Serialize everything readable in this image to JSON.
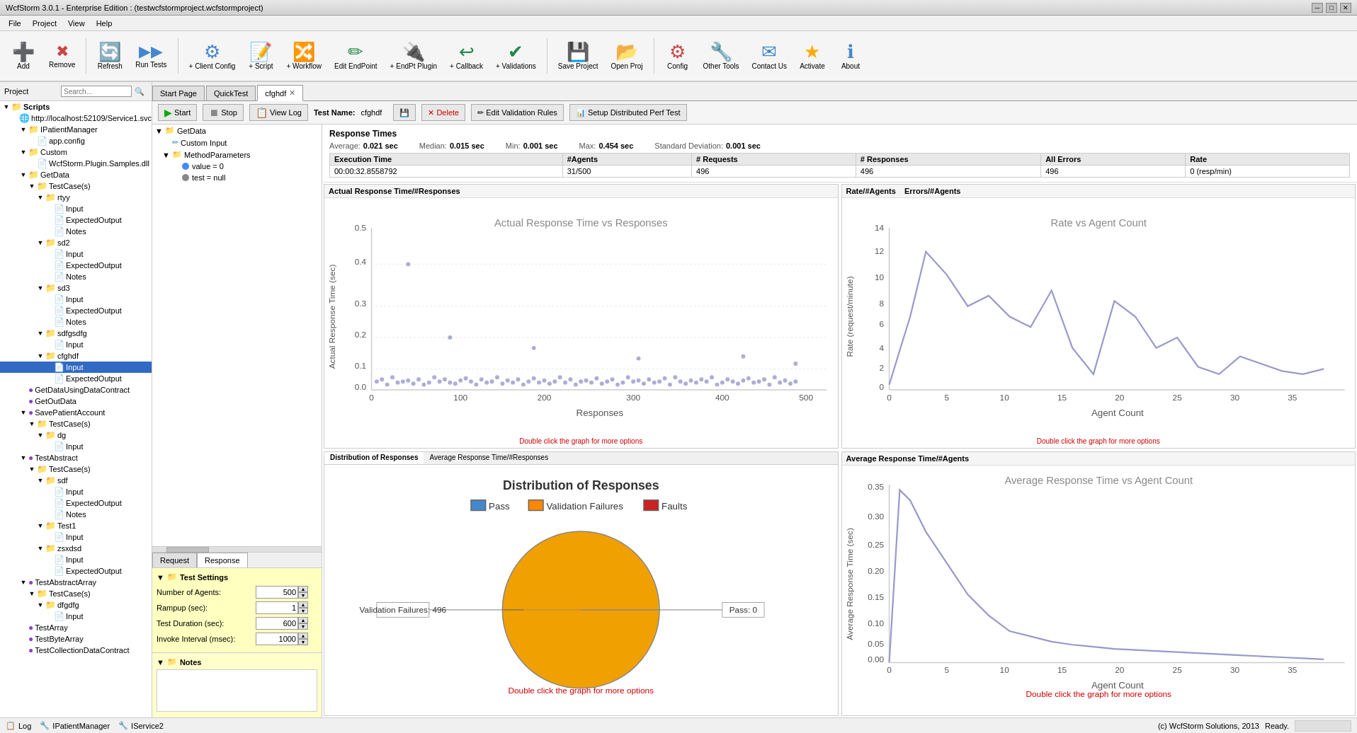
{
  "titleBar": {
    "text": "WcfStorm 3.0.1 - Enterprise Edition : (testwcfstormproject.wcfstormproject)",
    "minBtn": "─",
    "maxBtn": "□",
    "closeBtn": "✕"
  },
  "menuBar": {
    "items": [
      "File",
      "Project",
      "View",
      "Help"
    ]
  },
  "toolbar": {
    "buttons": [
      {
        "id": "add",
        "label": "Add",
        "icon": "➕",
        "class": "btn-add"
      },
      {
        "id": "remove",
        "label": "Remove",
        "icon": "✖",
        "class": "btn-remove"
      },
      {
        "id": "refresh",
        "label": "Refresh",
        "icon": "🔄",
        "class": "btn-refresh"
      },
      {
        "id": "run-tests",
        "label": "Run Tests",
        "icon": "▶",
        "class": "btn-run"
      },
      {
        "id": "client-config",
        "label": "+ Client Config",
        "icon": "⚙",
        "class": "btn-client"
      },
      {
        "id": "script",
        "label": "+ Script",
        "icon": "📝",
        "class": "btn-script"
      },
      {
        "id": "workflow",
        "label": "+ Workflow",
        "icon": "🔀",
        "class": "btn-workflow"
      },
      {
        "id": "edit-endpoint",
        "label": "Edit EndPoint",
        "icon": "✏",
        "class": "btn-endpoint"
      },
      {
        "id": "endpt-plugin",
        "label": "+ EndPt Plugin",
        "icon": "🔌",
        "class": "btn-endpt"
      },
      {
        "id": "callback",
        "label": "+ Callback",
        "icon": "↩",
        "class": "btn-callback"
      },
      {
        "id": "validations",
        "label": "+ Validations",
        "icon": "✔",
        "class": "btn-validations"
      },
      {
        "id": "save-project",
        "label": "Save Project",
        "icon": "💾",
        "class": "btn-save"
      },
      {
        "id": "open-proj",
        "label": "Open Proj",
        "icon": "📂",
        "class": "btn-openproj"
      },
      {
        "id": "config",
        "label": "Config",
        "icon": "⚙",
        "class": "btn-config"
      },
      {
        "id": "other-tools",
        "label": "Other Tools",
        "icon": "🔧",
        "class": "btn-tools"
      },
      {
        "id": "contact-us",
        "label": "Contact Us",
        "icon": "✉",
        "class": "btn-contact"
      },
      {
        "id": "activate",
        "label": "Activate",
        "icon": "★",
        "class": "btn-activate"
      },
      {
        "id": "about",
        "label": "About",
        "icon": "ℹ",
        "class": "btn-about"
      }
    ]
  },
  "projectPanel": {
    "header": "Project",
    "searchPlaceholder": "Search...",
    "tree": [
      {
        "id": 1,
        "indent": 0,
        "expand": "▼",
        "icon": "📁",
        "iconClass": "icon-folder",
        "label": "Scripts",
        "bold": true
      },
      {
        "id": 2,
        "indent": 1,
        "expand": " ",
        "icon": "🌐",
        "iconClass": "icon-blue",
        "label": "http://localhost:52109/Service1.svc"
      },
      {
        "id": 3,
        "indent": 2,
        "expand": "▼",
        "icon": "📁",
        "iconClass": "icon-folder",
        "label": "IPatientManager"
      },
      {
        "id": 4,
        "indent": 3,
        "expand": " ",
        "icon": "📄",
        "iconClass": "icon-gray",
        "label": "app.config"
      },
      {
        "id": 5,
        "indent": 2,
        "expand": "▼",
        "icon": "📁",
        "iconClass": "icon-folder",
        "label": "Custom"
      },
      {
        "id": 6,
        "indent": 3,
        "expand": " ",
        "icon": "📄",
        "iconClass": "icon-gray",
        "label": "WcfStorm.Plugin.Samples.dll"
      },
      {
        "id": 7,
        "indent": 2,
        "expand": "▼",
        "icon": "📁",
        "iconClass": "icon-folder",
        "label": "GetData"
      },
      {
        "id": 8,
        "indent": 3,
        "expand": "▼",
        "icon": "📁",
        "iconClass": "icon-folder",
        "label": "TestCase(s)"
      },
      {
        "id": 9,
        "indent": 4,
        "expand": "▼",
        "icon": "📁",
        "iconClass": "icon-folder",
        "label": "rtyy"
      },
      {
        "id": 10,
        "indent": 5,
        "expand": " ",
        "icon": "📄",
        "iconClass": "icon-orange",
        "label": "Input"
      },
      {
        "id": 11,
        "indent": 5,
        "expand": " ",
        "icon": "📄",
        "iconClass": "icon-green",
        "label": "ExpectedOutput"
      },
      {
        "id": 12,
        "indent": 5,
        "expand": " ",
        "icon": "📄",
        "iconClass": "icon-gray",
        "label": "Notes"
      },
      {
        "id": 13,
        "indent": 4,
        "expand": "▼",
        "icon": "📁",
        "iconClass": "icon-folder",
        "label": "sd2"
      },
      {
        "id": 14,
        "indent": 5,
        "expand": " ",
        "icon": "📄",
        "iconClass": "icon-orange",
        "label": "Input"
      },
      {
        "id": 15,
        "indent": 5,
        "expand": " ",
        "icon": "📄",
        "iconClass": "icon-green",
        "label": "ExpectedOutput"
      },
      {
        "id": 16,
        "indent": 5,
        "expand": " ",
        "icon": "📄",
        "iconClass": "icon-gray",
        "label": "Notes"
      },
      {
        "id": 17,
        "indent": 4,
        "expand": "▼",
        "icon": "📁",
        "iconClass": "icon-folder",
        "label": "sd3"
      },
      {
        "id": 18,
        "indent": 5,
        "expand": " ",
        "icon": "📄",
        "iconClass": "icon-orange",
        "label": "Input"
      },
      {
        "id": 19,
        "indent": 5,
        "expand": " ",
        "icon": "📄",
        "iconClass": "icon-green",
        "label": "ExpectedOutput"
      },
      {
        "id": 20,
        "indent": 5,
        "expand": " ",
        "icon": "📄",
        "iconClass": "icon-gray",
        "label": "Notes"
      },
      {
        "id": 21,
        "indent": 4,
        "expand": "▼",
        "icon": "📁",
        "iconClass": "icon-folder",
        "label": "sdfgsdfg"
      },
      {
        "id": 22,
        "indent": 5,
        "expand": " ",
        "icon": "📄",
        "iconClass": "icon-orange",
        "label": "Input"
      },
      {
        "id": 23,
        "indent": 4,
        "expand": "▼",
        "icon": "📁",
        "iconClass": "icon-folder",
        "label": "cfghdf"
      },
      {
        "id": 24,
        "indent": 5,
        "expand": " ",
        "icon": "📄",
        "iconClass": "icon-blue",
        "label": "Input",
        "selected": true
      },
      {
        "id": 25,
        "indent": 5,
        "expand": " ",
        "icon": "📄",
        "iconClass": "icon-green",
        "label": "ExpectedOutput"
      },
      {
        "id": 26,
        "indent": 2,
        "expand": " ",
        "icon": "📄",
        "iconClass": "icon-purple",
        "label": "GetDataUsingDataContract"
      },
      {
        "id": 27,
        "indent": 2,
        "expand": " ",
        "icon": "📄",
        "iconClass": "icon-purple",
        "label": "GetOutData"
      },
      {
        "id": 28,
        "indent": 2,
        "expand": " ",
        "icon": "📄",
        "iconClass": "icon-purple",
        "label": "SavePatientAccount"
      },
      {
        "id": 29,
        "indent": 3,
        "expand": "▼",
        "icon": "📁",
        "iconClass": "icon-folder",
        "label": "TestCase(s)"
      },
      {
        "id": 30,
        "indent": 4,
        "expand": "▼",
        "icon": "📁",
        "iconClass": "icon-folder",
        "label": "dg"
      },
      {
        "id": 31,
        "indent": 5,
        "expand": " ",
        "icon": "📄",
        "iconClass": "icon-orange",
        "label": "Input"
      },
      {
        "id": 32,
        "indent": 2,
        "expand": " ",
        "icon": "📄",
        "iconClass": "icon-purple",
        "label": "TestAbstract"
      },
      {
        "id": 33,
        "indent": 3,
        "expand": "▼",
        "icon": "📁",
        "iconClass": "icon-folder",
        "label": "TestCase(s)"
      },
      {
        "id": 34,
        "indent": 4,
        "expand": "▼",
        "icon": "📁",
        "iconClass": "icon-folder",
        "label": "sdf"
      },
      {
        "id": 35,
        "indent": 5,
        "expand": " ",
        "icon": "📄",
        "iconClass": "icon-orange",
        "label": "Input"
      },
      {
        "id": 36,
        "indent": 5,
        "expand": " ",
        "icon": "📄",
        "iconClass": "icon-green",
        "label": "ExpectedOutput"
      },
      {
        "id": 37,
        "indent": 5,
        "expand": " ",
        "icon": "📄",
        "iconClass": "icon-gray",
        "label": "Notes"
      },
      {
        "id": 38,
        "indent": 4,
        "expand": "▼",
        "icon": "📁",
        "iconClass": "icon-folder",
        "label": "Test1"
      },
      {
        "id": 39,
        "indent": 5,
        "expand": " ",
        "icon": "📄",
        "iconClass": "icon-orange",
        "label": "Input"
      },
      {
        "id": 40,
        "indent": 4,
        "expand": "▼",
        "icon": "📁",
        "iconClass": "icon-folder",
        "label": "zsxdsd"
      },
      {
        "id": 41,
        "indent": 5,
        "expand": " ",
        "icon": "📄",
        "iconClass": "icon-blue",
        "label": "Input"
      },
      {
        "id": 42,
        "indent": 5,
        "expand": " ",
        "icon": "📄",
        "iconClass": "icon-green",
        "label": "ExpectedOutput"
      },
      {
        "id": 43,
        "indent": 2,
        "expand": " ",
        "icon": "📄",
        "iconClass": "icon-purple",
        "label": "TestAbstractArray"
      },
      {
        "id": 44,
        "indent": 3,
        "expand": "▼",
        "icon": "📁",
        "iconClass": "icon-folder",
        "label": "TestCase(s)"
      },
      {
        "id": 45,
        "indent": 4,
        "expand": "▼",
        "icon": "📁",
        "iconClass": "icon-folder",
        "label": "dfgdfg"
      },
      {
        "id": 46,
        "indent": 5,
        "expand": " ",
        "icon": "📄",
        "iconClass": "icon-orange",
        "label": "Input"
      },
      {
        "id": 47,
        "indent": 2,
        "expand": " ",
        "icon": "📄",
        "iconClass": "icon-purple",
        "label": "TestArray"
      },
      {
        "id": 48,
        "indent": 2,
        "expand": " ",
        "icon": "📄",
        "iconClass": "icon-purple",
        "label": "TestByteArray"
      },
      {
        "id": 49,
        "indent": 2,
        "expand": " ",
        "icon": "📄",
        "iconClass": "icon-purple",
        "label": "TestCollectionDataContract"
      }
    ]
  },
  "tabs": {
    "items": [
      {
        "label": "Start Page",
        "closable": false,
        "active": false
      },
      {
        "label": "QuickTest",
        "closable": false,
        "active": false
      },
      {
        "label": "cfghdf",
        "closable": true,
        "active": true
      }
    ]
  },
  "testPanel": {
    "startBtn": "▶ Start",
    "stopBtn": "⏹ Stop",
    "viewLogBtn": "📋 View Log",
    "testNameLabel": "Test Name:",
    "testNameValue": "cfghdf",
    "saveBtn": "💾",
    "deleteBtn": "✕ Delete",
    "editValidationBtn": "✏ Edit Validation Rules",
    "setupDistBtn": "📊 Setup Distributed Perf Test"
  },
  "paramTree": {
    "nodes": [
      {
        "indent": 0,
        "expand": "▼",
        "bullet": null,
        "icon": "📁",
        "label": "GetData"
      },
      {
        "indent": 1,
        "expand": " ",
        "bullet": null,
        "icon": "✏",
        "label": "Custom Input"
      },
      {
        "indent": 1,
        "expand": "▼",
        "bullet": null,
        "icon": "📁",
        "label": "MethodParameters"
      },
      {
        "indent": 2,
        "expand": " ",
        "bullet": "blue",
        "icon": "",
        "label": "value = 0"
      },
      {
        "indent": 2,
        "expand": " ",
        "bullet": "gray",
        "icon": "",
        "label": "test = null"
      }
    ]
  },
  "reqResTabs": [
    "Request",
    "Response"
  ],
  "settings": {
    "title": "Test Settings",
    "fields": [
      {
        "label": "Number of Agents:",
        "value": "500"
      },
      {
        "label": "Rampup (sec):",
        "value": "1"
      },
      {
        "label": "Test Duration (sec):",
        "value": "600"
      },
      {
        "label": "Invoke Interval (msec):",
        "value": "1000"
      }
    ]
  },
  "notes": {
    "title": "Notes"
  },
  "responseTimes": {
    "title": "Response Times",
    "stats": [
      {
        "label": "Average:",
        "value": "0.021 sec"
      },
      {
        "label": "Median:",
        "value": "0.015 sec"
      },
      {
        "label": "Min:",
        "value": "0.001 sec"
      },
      {
        "label": "Max:",
        "value": "0.454 sec"
      },
      {
        "label": "Standard Deviation:",
        "value": "0.001 sec"
      }
    ]
  },
  "statsTable": {
    "headers": [
      "Execution Time",
      "#Agents",
      "# Requests",
      "# Responses",
      "All Errors",
      "Rate"
    ],
    "row": [
      "00:00:32.8558792",
      "31/500",
      "496",
      "496",
      "496",
      "0 (resp/min)"
    ]
  },
  "charts": {
    "topLeft": {
      "title": "Actual Response Time/#Responses",
      "chartTitle": "Actual Response Time vs Responses",
      "xLabel": "Responses",
      "yLabel": "Actual Response Time (sec)",
      "hint": "Double click the graph for more options"
    },
    "topRight": {
      "title": "Rate/#Agents   Errors/#Agents",
      "chartTitle": "Rate vs Agent Count",
      "xLabel": "Agent Count",
      "yLabel": "Rate (request/minute)",
      "hint": "Double click the graph for more options"
    },
    "bottomLeft": {
      "tabs": [
        "Distribution of Responses",
        "Average Response Time/#Responses"
      ],
      "activeTab": 0,
      "chartTitle": "Distribution of Responses",
      "legend": [
        {
          "label": "Pass",
          "color": "#4488cc"
        },
        {
          "label": "Validation Failures",
          "color": "#ff8800"
        },
        {
          "label": "Faults",
          "color": "#cc2222"
        }
      ],
      "hint": "Double click the graph for more options",
      "pieData": {
        "pass": 0,
        "validationFailures": 496,
        "passLabel": "Pass: 0",
        "validationLabel": "Validation Failures: 496"
      }
    },
    "bottomRight": {
      "title": "Average Response Time/#Agents",
      "chartTitle": "Average Response Time vs Agent Count",
      "xLabel": "Agent Count",
      "yLabel": "Average Response Time (sec)",
      "hint": "Double click the graph for more options"
    }
  },
  "statusBar": {
    "items": [
      "Log",
      "IPatientManager",
      "IService2"
    ],
    "rightText": "Ready."
  }
}
